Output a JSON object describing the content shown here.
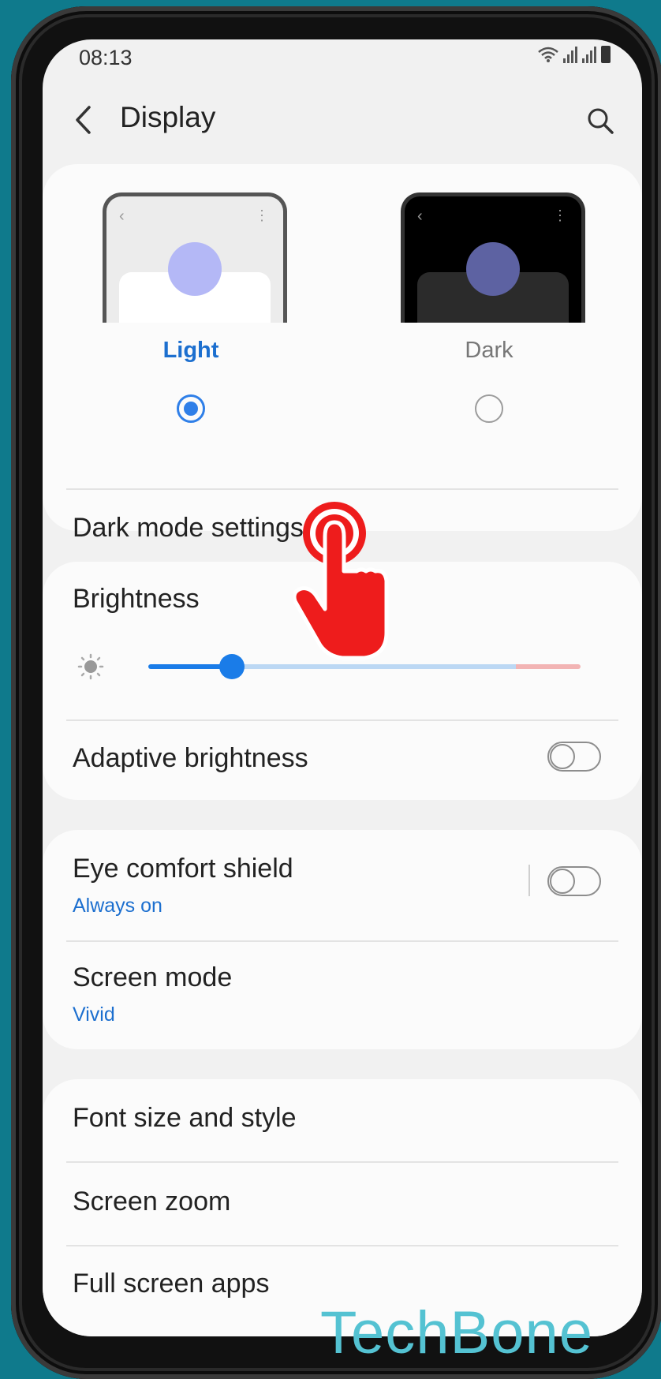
{
  "status_bar": {
    "time": "08:13"
  },
  "header": {
    "title": "Display"
  },
  "theme": {
    "light_label": "Light",
    "dark_label": "Dark",
    "selected": "Light",
    "accent": "#1c6fcf"
  },
  "rows": {
    "dark_mode_settings": "Dark mode settings",
    "brightness": "Brightness",
    "adaptive_brightness": "Adaptive brightness",
    "eye_comfort": "Eye comfort shield",
    "eye_comfort_sub": "Always on",
    "screen_mode": "Screen mode",
    "screen_mode_sub": "Vivid",
    "font_size": "Font size and style",
    "screen_zoom": "Screen zoom",
    "full_screen_apps": "Full screen apps"
  },
  "brightness_level": 0.19,
  "toggles": {
    "adaptive_brightness": false,
    "eye_comfort_shield": false
  },
  "watermark": "TechBone",
  "overlay": {
    "icon": "tap-hand-icon",
    "color": "#ee1c1c"
  }
}
